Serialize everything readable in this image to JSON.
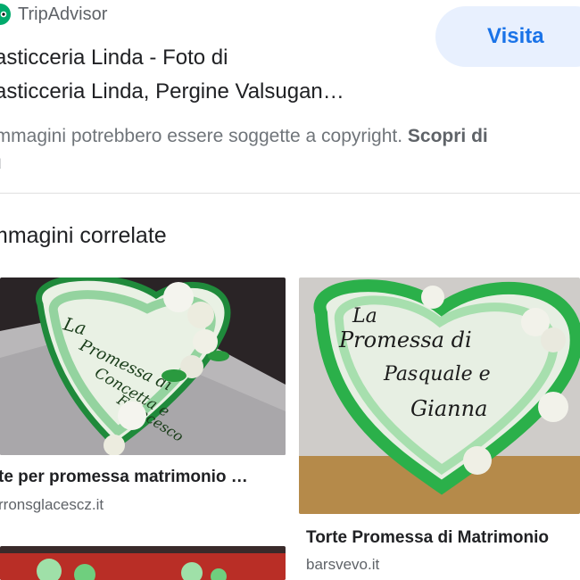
{
  "header": {
    "source_name": "TripAdvisor",
    "source_icon": "tripadvisor-owl-icon",
    "visit_label": "Visita",
    "title_line1": "asticceria Linda - Foto di",
    "title_line2": "asticceria Linda, Pergine Valsugan…",
    "copyright_text": " immagini potrebbero essere soggette a copyright. ",
    "copyright_link": "Scopri di",
    "copyright_line2": "ù"
  },
  "related": {
    "title": "mmagini correlate",
    "items": [
      {
        "title": "te per promessa matrimonio …",
        "site": "rronsglacescz.it",
        "image": "green heart cake 'La Promessa di Concetta e Francesco'"
      },
      {
        "title": "Torte Promessa di Matrimonio",
        "site": "barsvevo.it",
        "image": "green heart cake 'La Promessa di Pasquale e Gianna'"
      }
    ]
  },
  "colors": {
    "accent": "#1a73e8",
    "visit_bg": "#e8f0fe",
    "tripadvisor_green": "#00aa6c",
    "cake_green": "#2fa94a"
  }
}
